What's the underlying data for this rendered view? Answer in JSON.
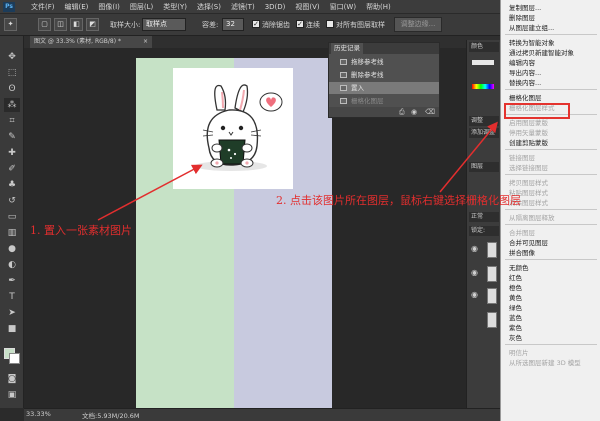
{
  "app": {
    "logo": "Ps"
  },
  "menubar": {
    "items": [
      "文件(F)",
      "编辑(E)",
      "图像(I)",
      "图层(L)",
      "类型(Y)",
      "选择(S)",
      "滤镜(T)",
      "3D(D)",
      "视图(V)",
      "窗口(W)",
      "帮助(H)"
    ]
  },
  "options": {
    "sample_size_label": "取样大小:",
    "sample_size_value": "取样点",
    "tolerance_label": "容差:",
    "tolerance_value": "32",
    "antialias_label": "消除锯齿",
    "contiguous_label": "连续",
    "all_layers_label": "对所有图层取样",
    "refine_edge_label": "调整边缘..."
  },
  "document": {
    "tab": "图文 @ 33.3% (素材, RGB/8) *",
    "close": "×"
  },
  "history": {
    "tab": "历史记录",
    "items": [
      {
        "label": "拖移参考线",
        "state": "normal"
      },
      {
        "label": "删除参考线",
        "state": "normal"
      },
      {
        "label": "置入",
        "state": "selected"
      },
      {
        "label": "栅格化图层",
        "state": "dim"
      }
    ]
  },
  "dock": {
    "tabs": [
      "颜色",
      "调整",
      "添加调整",
      "图层",
      "正常",
      "锁定:"
    ]
  },
  "context_menu": {
    "items": [
      {
        "label": "复制图层...",
        "state": "normal"
      },
      {
        "label": "删除图层",
        "state": "normal"
      },
      {
        "label": "从图层建立组...",
        "state": "normal"
      },
      {
        "sep": true
      },
      {
        "label": "转换为智能对象",
        "state": "normal"
      },
      {
        "label": "通过拷贝新建智能对象",
        "state": "normal"
      },
      {
        "label": "编辑内容",
        "state": "normal"
      },
      {
        "label": "导出内容...",
        "state": "normal"
      },
      {
        "label": "替换内容...",
        "state": "normal"
      },
      {
        "sep": true
      },
      {
        "label": "栅格化图层",
        "state": "highlighted"
      },
      {
        "label": "栅格化图层样式",
        "state": "dim"
      },
      {
        "sep": true
      },
      {
        "label": "启用图层蒙版",
        "state": "dim"
      },
      {
        "label": "停用矢量蒙版",
        "state": "dim"
      },
      {
        "label": "创建剪贴蒙版",
        "state": "normal"
      },
      {
        "sep": true
      },
      {
        "label": "链接图层",
        "state": "dim"
      },
      {
        "label": "选择链接图层",
        "state": "dim"
      },
      {
        "sep": true
      },
      {
        "label": "拷贝图层样式",
        "state": "dim"
      },
      {
        "label": "粘贴图层样式",
        "state": "dim"
      },
      {
        "label": "清除图层样式",
        "state": "dim"
      },
      {
        "sep": true
      },
      {
        "label": "从隔离图层释放",
        "state": "dim"
      },
      {
        "sep": true
      },
      {
        "label": "合并图层",
        "state": "dim"
      },
      {
        "label": "合并可见图层",
        "state": "normal"
      },
      {
        "label": "拼合图像",
        "state": "normal"
      },
      {
        "sep": true
      },
      {
        "label": "无颜色",
        "state": "normal"
      },
      {
        "label": "红色",
        "state": "normal"
      },
      {
        "label": "橙色",
        "state": "normal"
      },
      {
        "label": "黄色",
        "state": "normal"
      },
      {
        "label": "绿色",
        "state": "normal"
      },
      {
        "label": "蓝色",
        "state": "normal"
      },
      {
        "label": "紫色",
        "state": "normal"
      },
      {
        "label": "灰色",
        "state": "normal"
      },
      {
        "sep": true
      },
      {
        "label": "明信片",
        "state": "dim"
      },
      {
        "label": "从所选图层新建 3D 模型",
        "state": "dim"
      }
    ]
  },
  "annotations": {
    "step1": "1. 置入一张素材图片",
    "step2": "2. 点击该图片所在图层，鼠标右键选择栅格化图层"
  },
  "status": {
    "zoom": "33.33%",
    "doc_size": "文档:5.93M/20.6M"
  },
  "colors": {
    "accent_red": "#e4332e",
    "canvas_green": "#c6e2c6",
    "canvas_purple": "#c8cadf"
  }
}
